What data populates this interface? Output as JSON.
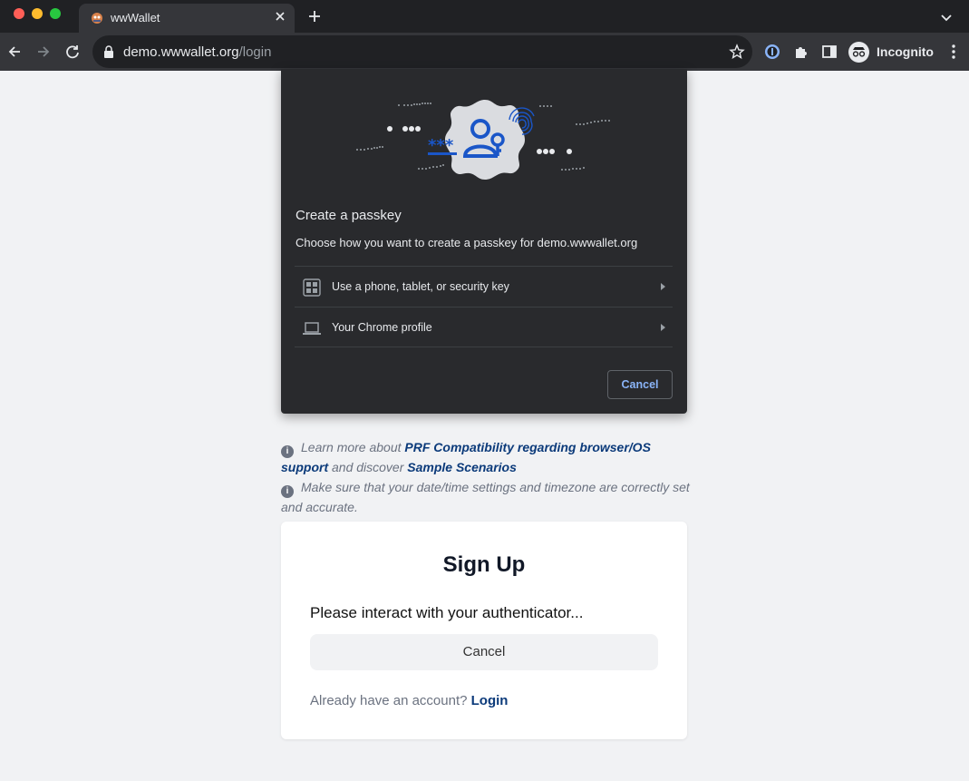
{
  "browser": {
    "tab_title": "wwWallet",
    "url_host": "demo.wwwallet.org",
    "url_path": "/login",
    "profile_label": "Incognito"
  },
  "dialog": {
    "title": "Create a passkey",
    "subtitle": "Choose how you want to create a passkey for demo.wwwallet.org",
    "options": [
      {
        "label": "Use a phone, tablet, or security key",
        "icon": "qr-code-icon"
      },
      {
        "label": "Your Chrome profile",
        "icon": "laptop-icon"
      }
    ],
    "cancel_label": "Cancel",
    "illustration_text": "***"
  },
  "info": {
    "prf_prefix": "Learn more about",
    "prf_link": "PRF Compatibility regarding browser/OS support",
    "prf_middle": "and discover",
    "scenarios_link": "Sample Scenarios",
    "datetime_text": "Make sure that your date/time settings and timezone are correctly set and accurate.",
    "icon_glyph": "i"
  },
  "signup": {
    "title": "Sign Up",
    "message": "Please interact with your authenticator...",
    "cancel_label": "Cancel",
    "login_prompt": "Already have an account?",
    "login_link": "Login"
  },
  "colors": {
    "chrome_dark": "#202124",
    "chrome_toolbar": "#35363a",
    "dialog_bg": "#292a2d",
    "page_bg": "#f1f2f4",
    "link": "#0b3a7a",
    "accent_blue": "#1a56c8"
  }
}
